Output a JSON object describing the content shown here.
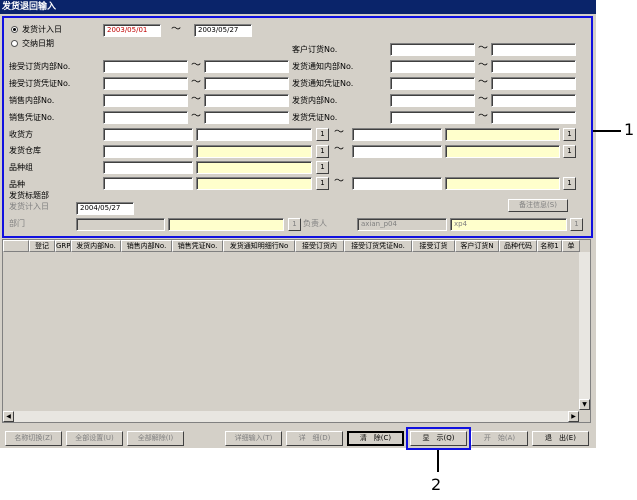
{
  "window": {
    "title": "发货退回输入"
  },
  "criteria": {
    "date_mode": {
      "options": [
        "发货计入日",
        "交纳日期"
      ],
      "selected": 0
    },
    "date_from": "2003/05/01",
    "date_to": "2003/05/27",
    "tilde": "～",
    "left_labels": [
      "接受订货内部No.",
      "接受订货凭证No.",
      "销售内部No.",
      "销售凭证No."
    ],
    "right_labels": [
      "客户订货No.",
      "发货通知内部No.",
      "发货通知凭证No.",
      "发货内部No.",
      "发货凭证No."
    ],
    "customer_label": "收货方",
    "warehouse_label": "发货仓库",
    "product_group_label": "品种组",
    "product_label": "品种",
    "lookup_btn": "1"
  },
  "header_section": {
    "title": "发货标题部",
    "ship_date_label": "发货计入日",
    "ship_date_value": "2004/05/27",
    "dept_label": "部门",
    "person_label": "负责人",
    "person_code": "axian_p04",
    "person_name": "xp4",
    "note_button": "备注信息(S)"
  },
  "grid": {
    "columns": [
      "登记",
      "GRP",
      "发货内部No.",
      "销售内部No.",
      "销售凭证No.",
      "发货通知明细行No",
      "接受订货内",
      "接受订货凭证No.",
      "接受订货",
      "客户订货N",
      "品种代码",
      "名称1",
      "单"
    ]
  },
  "toolbar": {
    "buttons": [
      "名称切换(Z)",
      "全部设置(U)",
      "全部解除(I)",
      "详细输入(T)",
      "详　细(D)",
      "清　除(C)",
      "显　示(Q)",
      "开　始(A)",
      "退　出(E)"
    ]
  },
  "callouts": {
    "one": "1",
    "two": "2"
  },
  "colors": {
    "title_bg": "#0a246a",
    "highlight": "#1010e0",
    "window_bg": "#d4d0c8",
    "required_bg": "#ffffcc",
    "date_red": "#c00000"
  }
}
